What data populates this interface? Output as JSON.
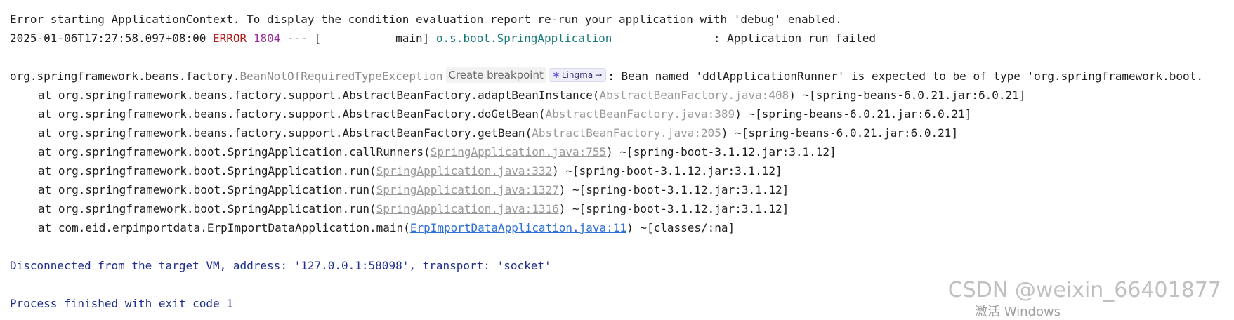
{
  "console": {
    "line1": "Error starting ApplicationContext. To display the condition evaluation report re-run your application with 'debug' enabled.",
    "line2": {
      "timestamp": "2025-01-06T17:27:58.097+08:00",
      "level": "ERROR",
      "pid": "1804",
      "sep": " --- [",
      "thread": "           main] ",
      "logger": "o.s.boot.SpringApplication",
      "message_gap": "               ",
      "message": ": Application run failed"
    },
    "exception": {
      "prefix": "org.springframework.beans.factory.",
      "type": "BeanNotOfRequiredTypeException",
      "create_breakpoint": "Create breakpoint",
      "lingma_label": "Lingma",
      "message": ": Bean named 'ddlApplicationRunner' is expected to be of type 'org.springframework.boot."
    },
    "frames": [
      {
        "before": "at org.springframework.beans.factory.support.AbstractBeanFactory.adaptBeanInstance(",
        "link": "AbstractBeanFactory.java:408",
        "after": ") ~[spring-beans-6.0.21.jar:6.0.21]",
        "user": false
      },
      {
        "before": "at org.springframework.beans.factory.support.AbstractBeanFactory.doGetBean(",
        "link": "AbstractBeanFactory.java:389",
        "after": ") ~[spring-beans-6.0.21.jar:6.0.21]",
        "user": false
      },
      {
        "before": "at org.springframework.beans.factory.support.AbstractBeanFactory.getBean(",
        "link": "AbstractBeanFactory.java:205",
        "after": ") ~[spring-beans-6.0.21.jar:6.0.21]",
        "user": false
      },
      {
        "before": "at org.springframework.boot.SpringApplication.callRunners(",
        "link": "SpringApplication.java:755",
        "after": ") ~[spring-boot-3.1.12.jar:3.1.12]",
        "user": false
      },
      {
        "before": "at org.springframework.boot.SpringApplication.run(",
        "link": "SpringApplication.java:332",
        "after": ") ~[spring-boot-3.1.12.jar:3.1.12]",
        "user": false
      },
      {
        "before": "at org.springframework.boot.SpringApplication.run(",
        "link": "SpringApplication.java:1327",
        "after": ") ~[spring-boot-3.1.12.jar:3.1.12]",
        "user": false
      },
      {
        "before": "at org.springframework.boot.SpringApplication.run(",
        "link": "SpringApplication.java:1316",
        "after": ") ~[spring-boot-3.1.12.jar:3.1.12]",
        "user": false
      },
      {
        "before": "at com.eid.erpimportdata.ErpImportDataApplication.main(",
        "link": "ErpImportDataApplication.java:11",
        "after": ") ~[classes/:na]",
        "user": true
      }
    ],
    "disconnected": "Disconnected from the target VM, address: '127.0.0.1:58098', transport: 'socket'",
    "finished": "Process finished with exit code 1"
  },
  "watermark": {
    "csdn": "CSDN @weixin_66401877",
    "activate": "激活 Windows"
  },
  "colors": {
    "error_level": "#b31b1b",
    "pid": "#9a2d9a",
    "logger": "#177a7a",
    "system_message": "#1f2f8f",
    "user_link": "#2f6fd6",
    "library_link": "#9a9a9a"
  }
}
